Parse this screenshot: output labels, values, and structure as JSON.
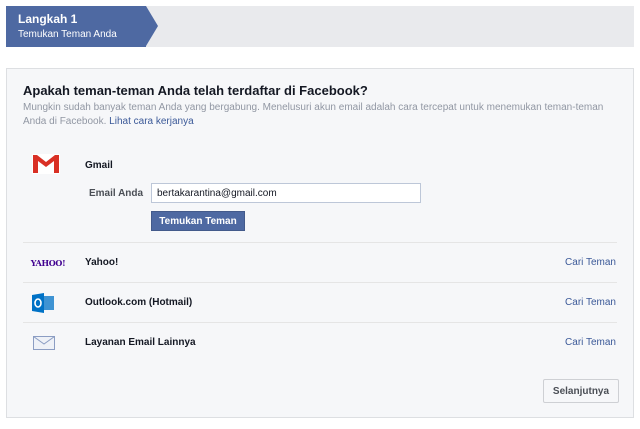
{
  "step": {
    "title": "Langkah 1",
    "subtitle": "Temukan Teman Anda"
  },
  "panel": {
    "heading": "Apakah teman-teman Anda telah terdaftar di Facebook?",
    "description": "Mungkin sudah banyak teman Anda yang bergabung. Menelusuri akun email adalah cara tercepat untuk menemukan teman-teman Anda di Facebook.",
    "how_it_works_link": "Lihat cara kerjanya"
  },
  "providers": {
    "gmail": {
      "name": "Gmail",
      "email_label": "Email Anda",
      "email_value": "bertakarantina@gmail.com",
      "find_button": "Temukan Teman",
      "icon": "gmail-icon"
    },
    "yahoo": {
      "name": "Yahoo!",
      "logo_text": "YAHOO!",
      "link": "Cari Teman",
      "icon": "yahoo-icon"
    },
    "outlook": {
      "name": "Outlook.com (Hotmail)",
      "link": "Cari Teman",
      "icon": "outlook-icon"
    },
    "other": {
      "name": "Layanan Email Lainnya",
      "link": "Cari Teman",
      "icon": "envelope-icon"
    }
  },
  "footer": {
    "next_button": "Selanjutnya"
  },
  "colors": {
    "step_bg": "#4e69a2",
    "link": "#3b5998",
    "gmail_red": "#d93025",
    "outlook_blue": "#0072c6",
    "yahoo_purple": "#400090"
  }
}
